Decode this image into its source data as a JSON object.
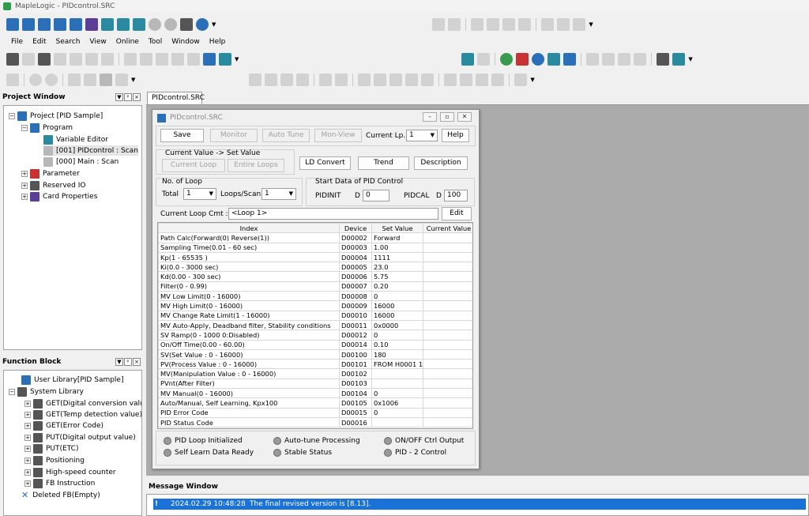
{
  "app": {
    "title": "MapleLogic - PIDcontrol.SRC"
  },
  "menu": [
    "File",
    "Edit",
    "Search",
    "View",
    "Online",
    "Tool",
    "Window",
    "Help"
  ],
  "project": {
    "header": "Project Window",
    "root": "Project [PID Sample]",
    "program": "Program",
    "variable_editor": "Variable Editor",
    "prog1": "[001] PIDcontrol : Scan",
    "prog2": "[000] Main : Scan",
    "parameter": "Parameter",
    "reserved_io": "Reserved IO",
    "card_props": "Card Properties"
  },
  "function_block": {
    "header": "Function Block",
    "user_lib": "User Library[PID Sample]",
    "sys_lib": "System Library",
    "items": [
      "GET(Digital conversion value)",
      "GET(Temp detection value)",
      "GET(Error Code)",
      "PUT(Digital output value)",
      "PUT(ETC)",
      "Positioning",
      "High-speed counter",
      "FB Instruction"
    ],
    "deleted": "Deleted FB(Empty)"
  },
  "doc_tab": "PIDcontrol.SRC",
  "dialog": {
    "title": "PIDcontrol.SRC",
    "buttons": {
      "save": "Save",
      "monitor": "Monitor",
      "auto_tune": "Auto Tune",
      "mon_view": "Mon-View",
      "help": "Help",
      "current_loop": "Current Loop",
      "entire_loops": "Entire Loops",
      "ld_convert": "LD Convert",
      "trend": "Trend",
      "description": "Description",
      "edit": "Edit"
    },
    "current_lp_label": "Current Lp.",
    "current_lp_value": "1",
    "cv_group": "Current Value -> Set Value",
    "no_loop_group": "No. of Loop",
    "total_label": "Total",
    "total_value": "1",
    "loops_scan_label": "Loops/Scan",
    "loops_scan_value": "1",
    "start_group": "Start Data of PID Control",
    "pidinit_label": "PIDINIT",
    "pidinit_dev": "D",
    "pidinit_value": "0",
    "pidcal_label": "PIDCAL",
    "pidcal_dev": "D",
    "pidcal_value": "100",
    "cmt_label": "Current Loop Cmt :",
    "cmt_value": "<Loop 1>",
    "table": {
      "headers": [
        "Index",
        "Device",
        "Set Value",
        "Current Value"
      ],
      "rows": [
        [
          "Path Calc(Forward(0) Reverse(1))",
          "D00002",
          "Forward",
          ""
        ],
        [
          "Sampling Time(0.01 - 60 sec)",
          "D00003",
          "1.00",
          ""
        ],
        [
          "Kp(1 - 65535 )",
          "D00004",
          "1111",
          ""
        ],
        [
          "Ki(0.0 - 3000 sec)",
          "D00005",
          "23.0",
          ""
        ],
        [
          "Kd(0.00 - 300 sec)",
          "D00006",
          "5.75",
          ""
        ],
        [
          "Filter(0 - 0.99)",
          "D00007",
          "0.20",
          ""
        ],
        [
          "MV Low Limit(0 - 16000)",
          "D00008",
          "0",
          ""
        ],
        [
          "MV High Limit(0 - 16000)",
          "D00009",
          "16000",
          ""
        ],
        [
          "MV Change Rate Limit(1 - 16000)",
          "D00010",
          "16000",
          ""
        ],
        [
          "MV Auto-Apply, Deadband filter, Stability conditions",
          "D00011",
          "0x0000",
          ""
        ],
        [
          "SV Ramp(0 - 1000    0:Disabled)",
          "D00012",
          "0",
          ""
        ],
        [
          "On/Off Time(0.00 - 60.00)",
          "D00014",
          "0.10",
          ""
        ],
        [
          "SV(Set Value : 0 - 16000)",
          "D00100",
          "180",
          ""
        ],
        [
          "PV(Process Value : 0 - 16000)",
          "D00101",
          "FROM H0001 1",
          ""
        ],
        [
          "MV(Manipulation Value : 0 - 16000)",
          "D00102",
          "",
          ""
        ],
        [
          "PVnt(After Filter)",
          "D00103",
          "",
          ""
        ],
        [
          "MV Manual(0 - 16000)",
          "D00104",
          "0",
          ""
        ],
        [
          "Auto/Manual, Self Learning, Kpx100",
          "D00105",
          "0x1006",
          ""
        ],
        [
          "PID Error Code",
          "D00015",
          "0",
          ""
        ],
        [
          "PID Status Code",
          "D00016",
          "",
          ""
        ]
      ]
    },
    "status": {
      "pid_loop_init": "PID Loop Initialized",
      "self_learn": "Self Learn Data Ready",
      "auto_tune_proc": "Auto-tune Processing",
      "stable": "Stable Status",
      "onoff": "ON/OFF Ctrl Output",
      "pid2": "PID - 2 Control"
    }
  },
  "message": {
    "header": "Message Window",
    "icon": "!",
    "time": "2024.02.29 10:48:28",
    "text": "The final revised version is [8.13]."
  },
  "colors": {
    "selection": "#1b72d6",
    "workspace": "#ababab"
  }
}
